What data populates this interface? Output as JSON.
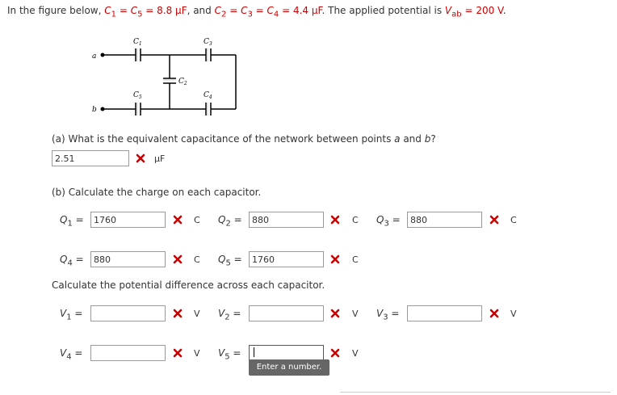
{
  "problem": {
    "prefix": "In the figure below, ",
    "c1": "C",
    "c1_sub": "1",
    "eq1": " = ",
    "c5": "C",
    "c5_sub": "5",
    "eq2": " = ",
    "value1": "8.8 μF",
    "mid": ", and ",
    "c2": "C",
    "c2_sub": "2",
    "eq3": " = ",
    "c3": "C",
    "c3_sub": "3",
    "eq4": " = ",
    "c4": "C",
    "c4_sub": "4",
    "eq5": " = ",
    "value2": "4.4 μF",
    "mid2": ". The applied potential is ",
    "vab": "V",
    "vab_sub": "ab",
    "eq6": " = ",
    "value3": "200 V",
    "end": "."
  },
  "figure": {
    "label_a": "a",
    "label_b": "b",
    "c1": "C",
    "c1_sub": "1",
    "c2": "C",
    "c2_sub": "2",
    "c3": "C",
    "c3_sub": "3",
    "c4": "C",
    "c4_sub": "4",
    "c5": "C",
    "c5_sub": "5"
  },
  "part_a": {
    "question_prefix": "(a) What is the equivalent capacitance of the network between points ",
    "a": "a",
    "and": " and ",
    "b": "b",
    "q_end": "?",
    "answer": "2.51",
    "unit": "μF"
  },
  "part_b": {
    "question": "(b) Calculate the charge on each capacitor.",
    "charges": [
      {
        "sym": "Q",
        "sub": "1",
        "eq": " =",
        "value": "1760",
        "unit": "C"
      },
      {
        "sym": "Q",
        "sub": "2",
        "eq": " =",
        "value": "880",
        "unit": "C"
      },
      {
        "sym": "Q",
        "sub": "3",
        "eq": " =",
        "value": "880",
        "unit": "C"
      },
      {
        "sym": "Q",
        "sub": "4",
        "eq": " =",
        "value": "880",
        "unit": "C"
      },
      {
        "sym": "Q",
        "sub": "5",
        "eq": " =",
        "value": "1760",
        "unit": "C"
      }
    ],
    "potential_question": "Calculate the potential difference across each capacitor.",
    "voltages": [
      {
        "sym": "V",
        "sub": "1",
        "eq": " =",
        "value": "",
        "unit": "V"
      },
      {
        "sym": "V",
        "sub": "2",
        "eq": " =",
        "value": "",
        "unit": "V"
      },
      {
        "sym": "V",
        "sub": "3",
        "eq": " =",
        "value": "",
        "unit": "V"
      },
      {
        "sym": "V",
        "sub": "4",
        "eq": " =",
        "value": "",
        "unit": "V"
      },
      {
        "sym": "V",
        "sub": "5",
        "eq": " =",
        "value": "",
        "unit": "V"
      }
    ]
  },
  "tooltip": "Enter a number.",
  "colors": {
    "accent": "#cc0000",
    "wrong": "#cc0000"
  },
  "icons": {
    "wrong": "x-mark-icon"
  }
}
